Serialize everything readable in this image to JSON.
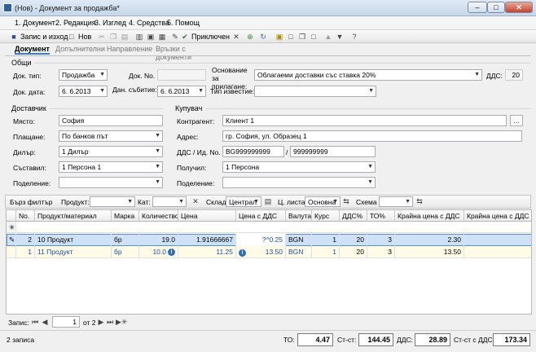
{
  "window": {
    "title": "(Нов) - Документ за продажба*",
    "minimize": "–",
    "maximize": "□",
    "close": "✕"
  },
  "menu": [
    "1. Документ",
    "2. Редакция",
    "3. Изглед",
    "4. Средства",
    "5. Помощ"
  ],
  "toolbar": {
    "save_exit": "Запис и изход",
    "new": "Нов",
    "finish": "Приключен"
  },
  "tabs": [
    "Документ",
    "Допълнителни",
    "Направление",
    "Връзки с документи"
  ],
  "general": {
    "group": "Общи",
    "doc_type_label": "Док. тип:",
    "doc_type": "Продажба",
    "doc_no_label": "Док. No.",
    "doc_no": "",
    "basis_label": "Основание\nза прилагане:",
    "basis": "Облагаеми доставки със ставка 20%",
    "vat_label": "ДДС:",
    "vat": "20",
    "doc_date_label": "Док. дата:",
    "doc_date": "6.  6.2013",
    "tax_event_label": "Дан. събитие:",
    "tax_event": "6.  6.2013",
    "notice_type_label": "Тип известие:",
    "notice_type": ""
  },
  "supplier": {
    "group": "Доставчик",
    "place_label": "Място:",
    "place": "София",
    "payment_label": "Плащане:",
    "payment": "По банков път",
    "dealer_label": "Дилър:",
    "dealer": "1 Дилър",
    "author_label": "Съставил:",
    "author": "1 Персона 1",
    "division_label": "Поделение:",
    "division": ""
  },
  "buyer": {
    "group": "Купувач",
    "contractor_label": "Контрагент:",
    "contractor": "Клиент 1",
    "address_label": "Адрес:",
    "address": "гр. София, ул. Образец 1",
    "vatid_label": "ДДС / Ид. No.",
    "vat_no": "BG999999999",
    "id_sep": "/",
    "id_no": "999999999",
    "received_label": "Получил:",
    "received": "1 Персона",
    "division_label": "Поделение:",
    "division": "",
    "browse": "..."
  },
  "filter": {
    "quick_label": "Бърз филтър",
    "product_label": "Продукт:",
    "cat_label": "Кат:",
    "warehouse_label": "Склад",
    "warehouse": "Централ",
    "pricelist_label": "Ц. листа",
    "pricelist": "Основна",
    "scheme_label": "Схема",
    "scheme": ""
  },
  "grid": {
    "columns": [
      "No.",
      "Продукт/материал",
      "Марка",
      "Количество",
      "Цена",
      "Цена с ДДС",
      "Валута",
      "Курс",
      "ДДС%",
      "ТО%",
      "Крайна цена с ДДС",
      "Крайна цена с ДДС и"
    ],
    "rows": [
      {
        "indicator": "✎",
        "no": "2",
        "product": "10 Продукт",
        "brand": "бр",
        "qty": "19.0",
        "price": "1.91666667",
        "price_vat": "?^0.25",
        "currency": "BGN",
        "rate": "1",
        "vat": "20",
        "to": "3",
        "final": "2.30"
      },
      {
        "indicator": "",
        "no": "1",
        "product": "11 Продукт",
        "brand": "бр",
        "qty": "10.0",
        "price": "11.25",
        "price_vat": "13.50",
        "currency": "BGN",
        "rate": "1",
        "vat": "20",
        "to": "3",
        "final": "13.50"
      }
    ]
  },
  "nav": {
    "records_label": "Запис:",
    "current": "1",
    "of": "от 2"
  },
  "status": {
    "count": "2 записа",
    "to_label": "ТО:",
    "to": "4.47",
    "cost_label": "Ст-ст:",
    "cost": "144.45",
    "vat_label": "ДДС:",
    "vat": "28.89",
    "total_label": "Ст-ст с ДДС:",
    "total": "173.34"
  }
}
